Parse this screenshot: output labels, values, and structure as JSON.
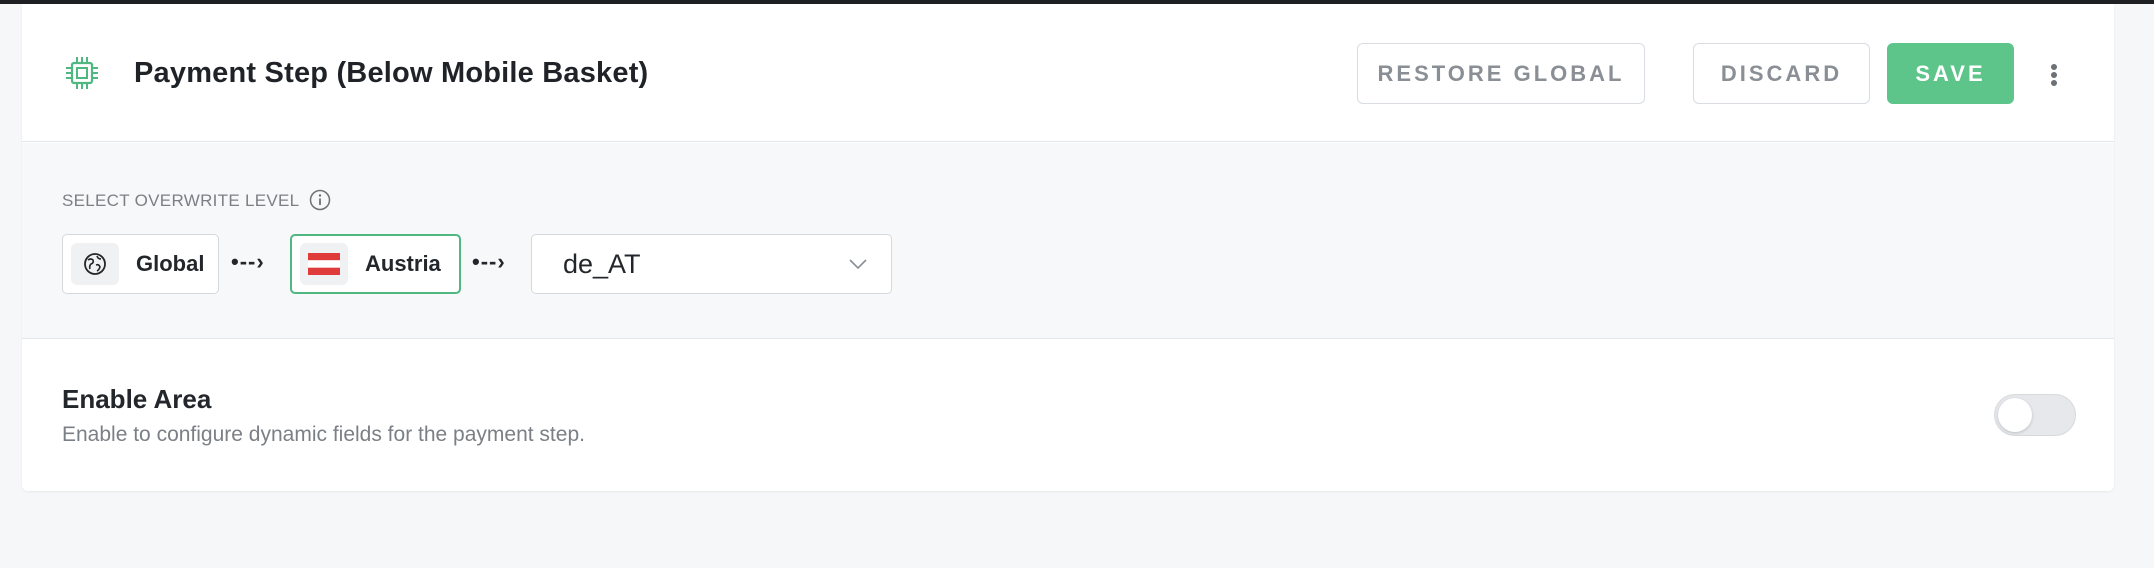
{
  "header": {
    "title": "Payment Step (Below Mobile Basket)",
    "icon": "chip-icon",
    "buttons": {
      "restore": "RESTORE GLOBAL",
      "discard": "DISCARD",
      "save": "SAVE"
    }
  },
  "overwrite": {
    "label": "SELECT OVERWRITE LEVEL",
    "levels": [
      {
        "label": "Global",
        "icon": "globe-icon",
        "selected": false
      },
      {
        "label": "Austria",
        "icon": "austria-flag-icon",
        "selected": true
      }
    ],
    "arrow": "•--›",
    "locale_select": {
      "value": "de_AT"
    }
  },
  "enable_area": {
    "title": "Enable Area",
    "description": "Enable to configure dynamic fields for the payment step.",
    "enabled": false
  },
  "colors": {
    "accent": "#5dc58a",
    "selected_border": "#4fb77f",
    "flag_red": "#e03b3b"
  }
}
